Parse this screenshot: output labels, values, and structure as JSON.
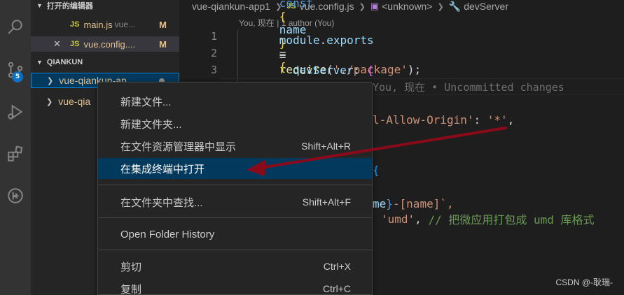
{
  "sidebar": {
    "open_editors_title": "打开的编辑器",
    "open_editors": [
      {
        "type": "JS",
        "name": "main.js",
        "folder": "vue...",
        "status": "M"
      },
      {
        "type": "JS",
        "name": "vue.config....",
        "folder": "",
        "status": "M"
      }
    ],
    "workspace_title": "QIANKUN",
    "tree": [
      {
        "label": "vue-qiankun-ap..."
      },
      {
        "label": "vue-qia"
      }
    ],
    "scm_badge": "5"
  },
  "breadcrumb": {
    "folder": "vue-qiankun-app1",
    "file_type": "JS",
    "file": "vue.config.js",
    "symbol": "<unknown>",
    "property": "devServer"
  },
  "codelens": "You, 现在 | 1 author (You)",
  "code": {
    "line_numbers": [
      "1",
      "2",
      "3"
    ],
    "line1": {
      "kw": "const",
      "open": "{",
      "var": "name",
      "close": "}",
      "eq": "=",
      "fn": "require",
      "str": "'./package'",
      "end": ");"
    },
    "line2": {
      "obj": "module",
      "prop": "exports",
      "eq": "=",
      "open": "{"
    },
    "line3": {
      "prop": "devServer",
      "open": "{"
    },
    "blame": "You, 现在 • Uncommitted changes",
    "fragment_origin_key": "l-Allow-Origin'",
    "fragment_origin_val": "'*'",
    "fragment_brace": "{",
    "fragment_name_var": "me",
    "fragment_name_close": "}",
    "fragment_name_rest": "-[name]`,",
    "fragment_umd_str": "'umd'",
    "fragment_umd_comment": "// 把微应用打包成 umd 库格式"
  },
  "context_menu": {
    "items": [
      {
        "label": "新建文件...",
        "shortcut": ""
      },
      {
        "label": "新建文件夹...",
        "shortcut": ""
      },
      {
        "label": "在文件资源管理器中显示",
        "shortcut": "Shift+Alt+R"
      },
      {
        "label": "在集成终端中打开",
        "shortcut": ""
      },
      {
        "label": "在文件夹中查找...",
        "shortcut": "Shift+Alt+F"
      },
      {
        "label": "Open Folder History",
        "shortcut": ""
      },
      {
        "label": "剪切",
        "shortcut": "Ctrl+X"
      },
      {
        "label": "复制",
        "shortcut": "Ctrl+C"
      }
    ]
  },
  "watermark": "CSDN @-耿瑞-",
  "colors": {
    "highlight": "#04395e",
    "arrow": "#8b0a1a",
    "modified": "#e2c08d",
    "badge": "#0e70c0"
  }
}
